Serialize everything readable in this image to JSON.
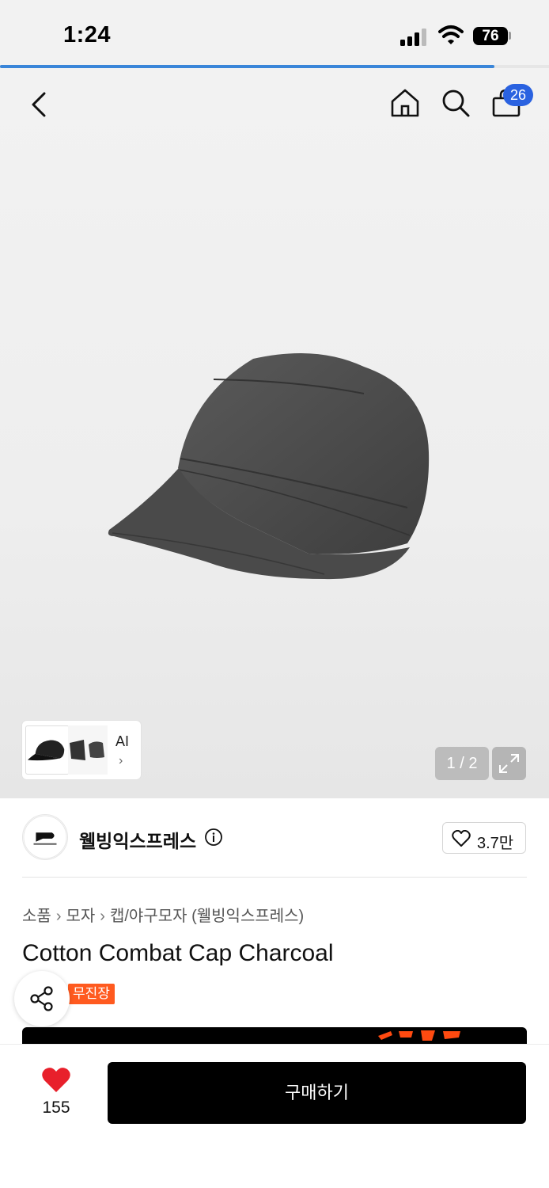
{
  "status_bar": {
    "time": "1:24",
    "battery": "76"
  },
  "gallery": {
    "progress_fraction": 0.9,
    "cart_count": "26",
    "thumbnail_ai_label": "AI",
    "thumbnail_chevron": "›",
    "page_counter": "1 / 2"
  },
  "brand": {
    "name": "웰빙익스프레스",
    "likes": "3.7만"
  },
  "breadcrumb": [
    "소품",
    "모자",
    "캡/야구모자 (웰빙익스프레스)"
  ],
  "breadcrumb_separator": "›",
  "product": {
    "title": "Cotton Combat Cap Charcoal",
    "tag": "무진장"
  },
  "bottom_bar": {
    "wish_count": "155",
    "buy_label": "구매하기"
  },
  "colors": {
    "accent_blue": "#2a62e0",
    "tag_orange": "#ff5a1f",
    "heart_red": "#e8202b",
    "buy_black": "#000000"
  },
  "icons": [
    "back-icon",
    "home-icon",
    "search-icon",
    "shopping-bag-icon",
    "expand-icon",
    "info-icon",
    "heart-outline-icon",
    "share-icon",
    "heart-filled-icon"
  ]
}
